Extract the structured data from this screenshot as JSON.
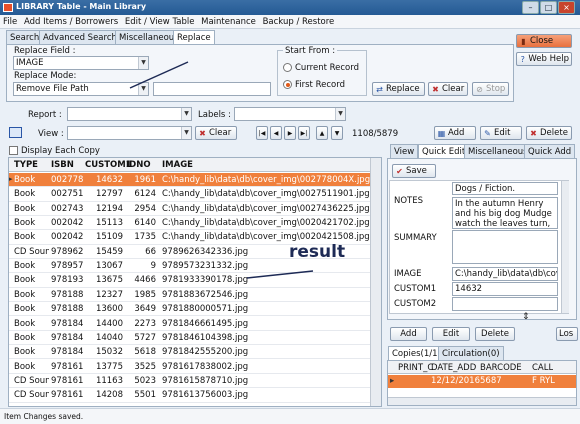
{
  "window": {
    "title": "LIBRARY Table - Main Library"
  },
  "menu": [
    "File",
    "Add Items / Borrowers",
    "Edit / View Table",
    "Maintenance",
    "Backup / Restore"
  ],
  "tabs": [
    "Search",
    "Advanced Search",
    "Miscellaneous",
    "Replace"
  ],
  "replace": {
    "field_label": "Replace Field :",
    "field_value": "IMAGE",
    "mode_label": "Replace Mode:",
    "mode_value": "Remove File Path",
    "start_label": "Start From :",
    "opt_current": "Current Record",
    "opt_first": "First Record",
    "btn_replace": "Replace",
    "btn_clear": "Clear",
    "btn_stop": "Stop"
  },
  "top_buttons": {
    "close": "Close",
    "webhelp": "Web Help"
  },
  "filters": {
    "report_label": "Report :",
    "labels_label": "Labels :",
    "view_label": "View :",
    "btn_clear": "Clear",
    "record_counter": "1108/5879",
    "btn_add": "Add",
    "btn_edit": "Edit",
    "btn_delete": "Delete",
    "display_each_copy": "Display Each Copy"
  },
  "grid": {
    "columns": [
      "TYPE",
      "ISBN",
      "CUSTOM1",
      "IDNO",
      "IMAGE"
    ],
    "rows": [
      [
        "Book",
        "0027780",
        "14632",
        "1961",
        "C:\\handy_lib\\data\\db\\cover_img\\002778004X.jpg"
      ],
      [
        "Book",
        "0027511",
        "12797",
        "6124",
        "C:\\handy_lib\\data\\db\\cover_img\\0027511901.jpg"
      ],
      [
        "Book",
        "0027436",
        "12194",
        "2954",
        "C:\\handy_lib\\data\\db\\cover_img\\0027436225.jpg"
      ],
      [
        "Book",
        "0020421",
        "15113",
        "6140",
        "C:\\handy_lib\\data\\db\\cover_img\\0020421702.jpg"
      ],
      [
        "Book",
        "0020421",
        "15109",
        "1735",
        "C:\\handy_lib\\data\\db\\cover_img\\0020421508.jpg"
      ],
      [
        "CD Soun",
        "9789626",
        "15459",
        "66",
        "9789626342336.jpg"
      ],
      [
        "Book",
        "9789573",
        "13067",
        "9",
        "9789573231332.jpg"
      ],
      [
        "Book",
        "9781933",
        "13675",
        "4466",
        "9781933390178.jpg"
      ],
      [
        "Book",
        "9781883",
        "12327",
        "1985",
        "9781883672546.jpg"
      ],
      [
        "Book",
        "9781880",
        "13600",
        "3649",
        "9781880000571.jpg"
      ],
      [
        "Book",
        "9781846",
        "14400",
        "2273",
        "9781846661495.jpg"
      ],
      [
        "Book",
        "9781846",
        "14040",
        "5727",
        "9781846104398.jpg"
      ],
      [
        "Book",
        "9781842",
        "15032",
        "5618",
        "9781842555200.jpg"
      ],
      [
        "Book",
        "9781617",
        "13775",
        "3525",
        "9781617838002.jpg"
      ],
      [
        "CD Soun",
        "9781615",
        "11163",
        "5023",
        "9781615878710.jpg"
      ],
      [
        "CD Soun",
        "9781613",
        "14208",
        "5501",
        "9781613756003.jpg"
      ]
    ]
  },
  "annotation": {
    "result": "result"
  },
  "side_tabs": [
    "View",
    "Quick Edit",
    "Miscellaneous",
    "Quick Add"
  ],
  "quick_edit": {
    "save": "Save",
    "desc_line": "Dogs / Fiction.",
    "notes_label": "NOTES",
    "notes_lines": [
      "In the autumn Henry",
      "and his big dog Mudge",
      "watch the leaves turn,"
    ],
    "summary_label": "SUMMARY",
    "image_label": "IMAGE",
    "image_value": "C:\\handy_lib\\data\\db\\cover",
    "custom1_label": "CUSTOM1",
    "custom1_value": "14632",
    "custom2_label": "CUSTOM2",
    "custom2_value": ""
  },
  "copies": {
    "btn_add": "Add",
    "btn_edit": "Edit",
    "btn_delete": "Delete",
    "btn_more": "Los",
    "tab_copies": "Copies(1/1)",
    "tab_circ": "Circulation(0)",
    "columns": [
      "PRINT_C",
      "DATE_ADD",
      "BARCODE",
      "CALL"
    ],
    "row": [
      "",
      "12/12/2016",
      "5687",
      "F RYL"
    ]
  },
  "status": "Item Changes saved."
}
